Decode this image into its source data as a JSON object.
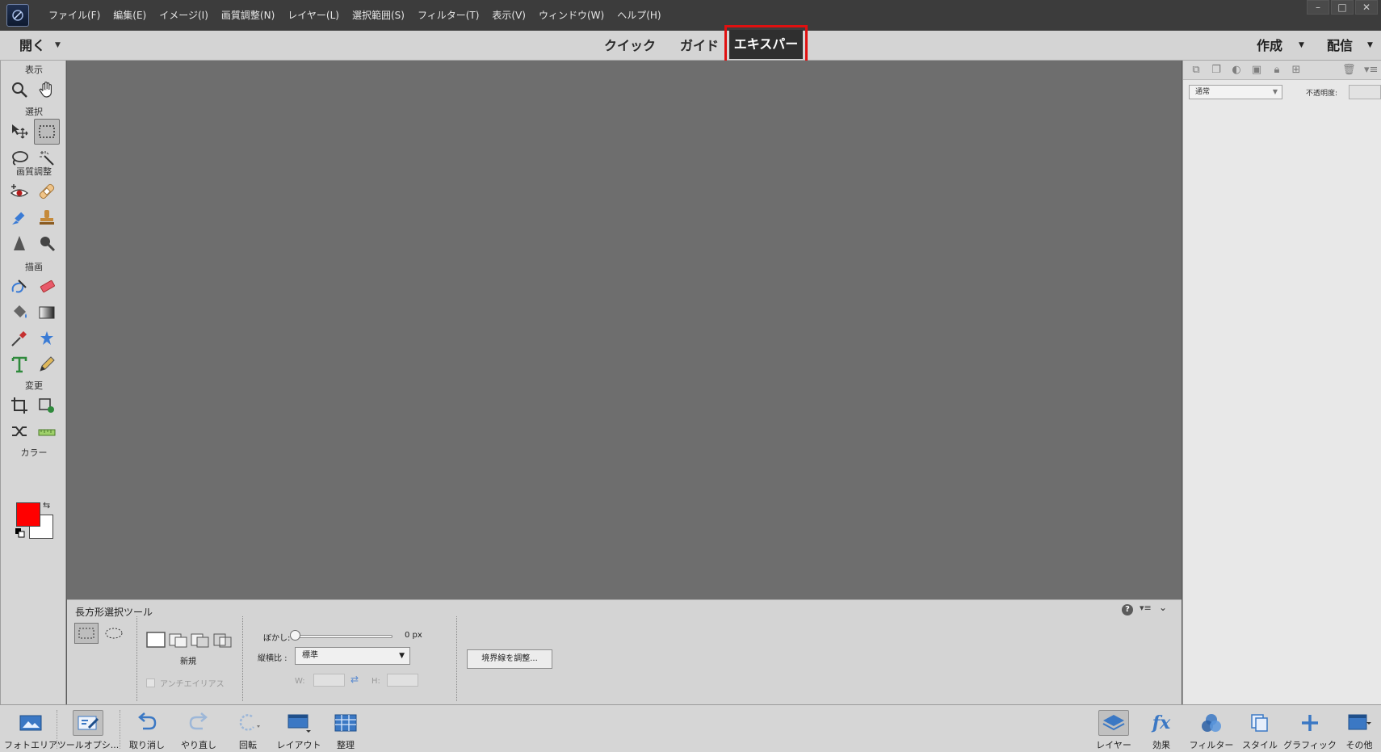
{
  "menubar": {
    "items": [
      "ファイル(F)",
      "編集(E)",
      "イメージ(I)",
      "画質調整(N)",
      "レイヤー(L)",
      "選択範囲(S)",
      "フィルター(T)",
      "表示(V)",
      "ウィンドウ(W)",
      "ヘルプ(H)"
    ]
  },
  "modebar": {
    "open_label": "開く",
    "tabs": [
      "クイック",
      "ガイド",
      "エキスパート"
    ],
    "active_tab": "エキスパート",
    "create_label": "作成",
    "share_label": "配信"
  },
  "toolbox": {
    "sections": [
      "表示",
      "選択",
      "画質調整",
      "描画",
      "変更",
      "カラー"
    ],
    "foreground_color": "#ff0000",
    "background_color": "#ffffff"
  },
  "tool_options": {
    "title": "長方形選択ツール",
    "new_label": "新規",
    "antialias_label": "アンチエイリアス",
    "feather_label": "ぼかし:",
    "feather_value": "0 px",
    "aspect_label": "縦横比 :",
    "aspect_value": "標準",
    "w_label": "W:",
    "h_label": "H:",
    "refine_edge_label": "境界線を調整..."
  },
  "right_panel": {
    "blend_mode": "通常",
    "opacity_label": "不透明度:"
  },
  "bottombar": {
    "left": [
      "フォトエリア",
      "ツールオプシ...",
      "取り消し",
      "やり直し",
      "回転",
      "レイアウト",
      "整理"
    ],
    "right": [
      "レイヤー",
      "効果",
      "フィルター",
      "スタイル",
      "グラフィック",
      "その他"
    ]
  },
  "colors": {
    "highlight_border": "#e01010",
    "menubar_bg": "#3c3c3c",
    "canvas_bg": "#6e6e6e"
  }
}
